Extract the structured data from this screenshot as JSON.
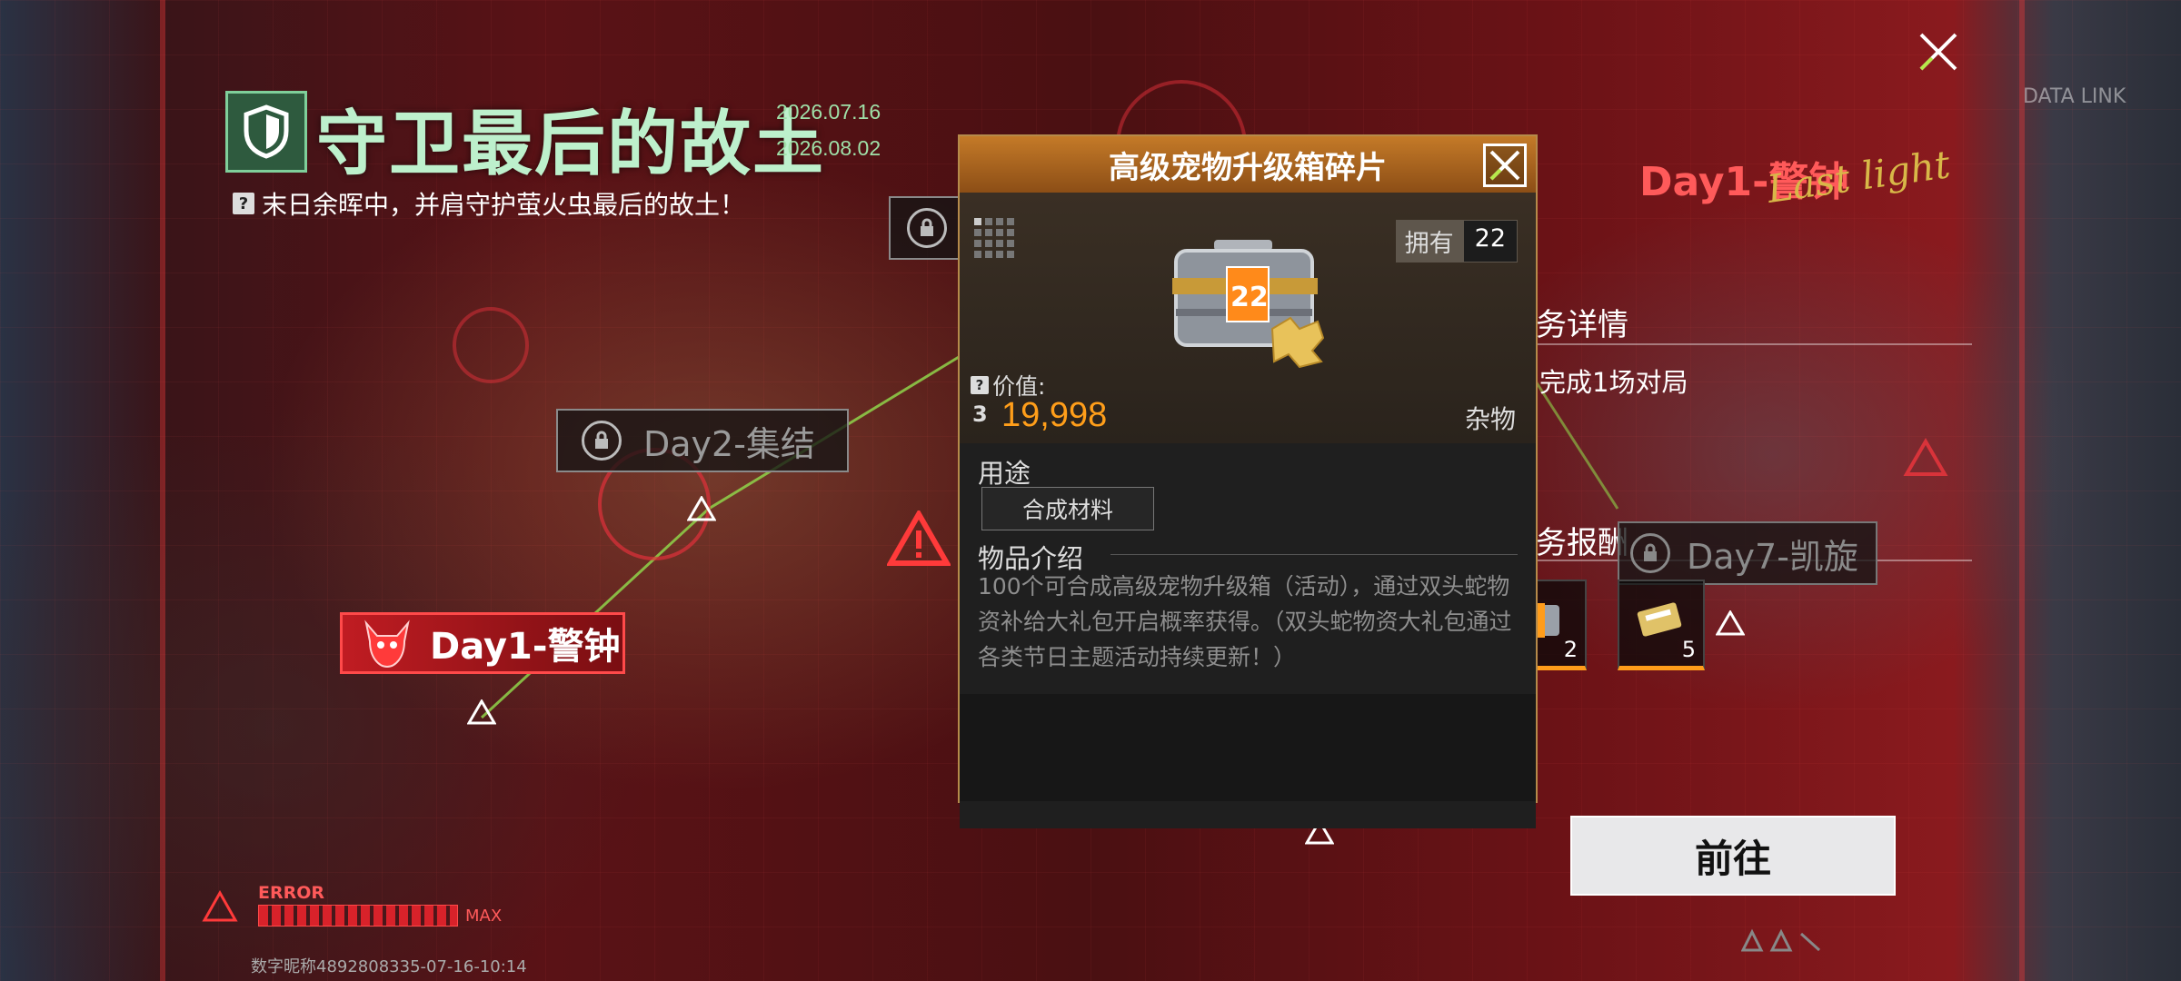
{
  "event": {
    "title": "守卫最后的故土",
    "date_start": "2026.07.16",
    "date_end": "2026.08.02",
    "subtitle": "末日余晖中，并肩守护萤火虫最后的故土！"
  },
  "map": {
    "day1_label": "Day1-警钟",
    "day2_label": "Day2-集结",
    "day7_label": "Day7-凯旋",
    "error_label": "ERROR",
    "max_label": "MAX",
    "data_link": "DATA LINK"
  },
  "side_panel": {
    "day_title": "Day1-警钟",
    "script_text": "Last light",
    "task_details_head": "务详情",
    "task_desc": "完成1场对局",
    "task_reward_head": "务报酬",
    "rewards": [
      {
        "count": "2"
      },
      {
        "count": "5"
      }
    ],
    "go_button": "前往"
  },
  "popup": {
    "title": "高级宠物升级箱碎片",
    "owned_label": "拥有",
    "owned_count": "22",
    "item_badge": "22",
    "value_label": "价值:",
    "value_amount": "19,998",
    "category": "杂物",
    "usage_title": "用途",
    "usage_chip": "合成材料",
    "intro_title": "物品介绍",
    "intro_text": "100个可合成高级宠物升级箱（活动），通过双头蛇物资补给大礼包开启概率获得。（双头蛇物资大礼包通过各类节日主题活动持续更新！）"
  },
  "footer": {
    "player_id": "数字昵称4892808335-07-16-10:14"
  },
  "colors": {
    "accent_orange": "#ff9e1a",
    "title_green": "#bdf0cc",
    "alert_red": "#ff4a4a"
  }
}
